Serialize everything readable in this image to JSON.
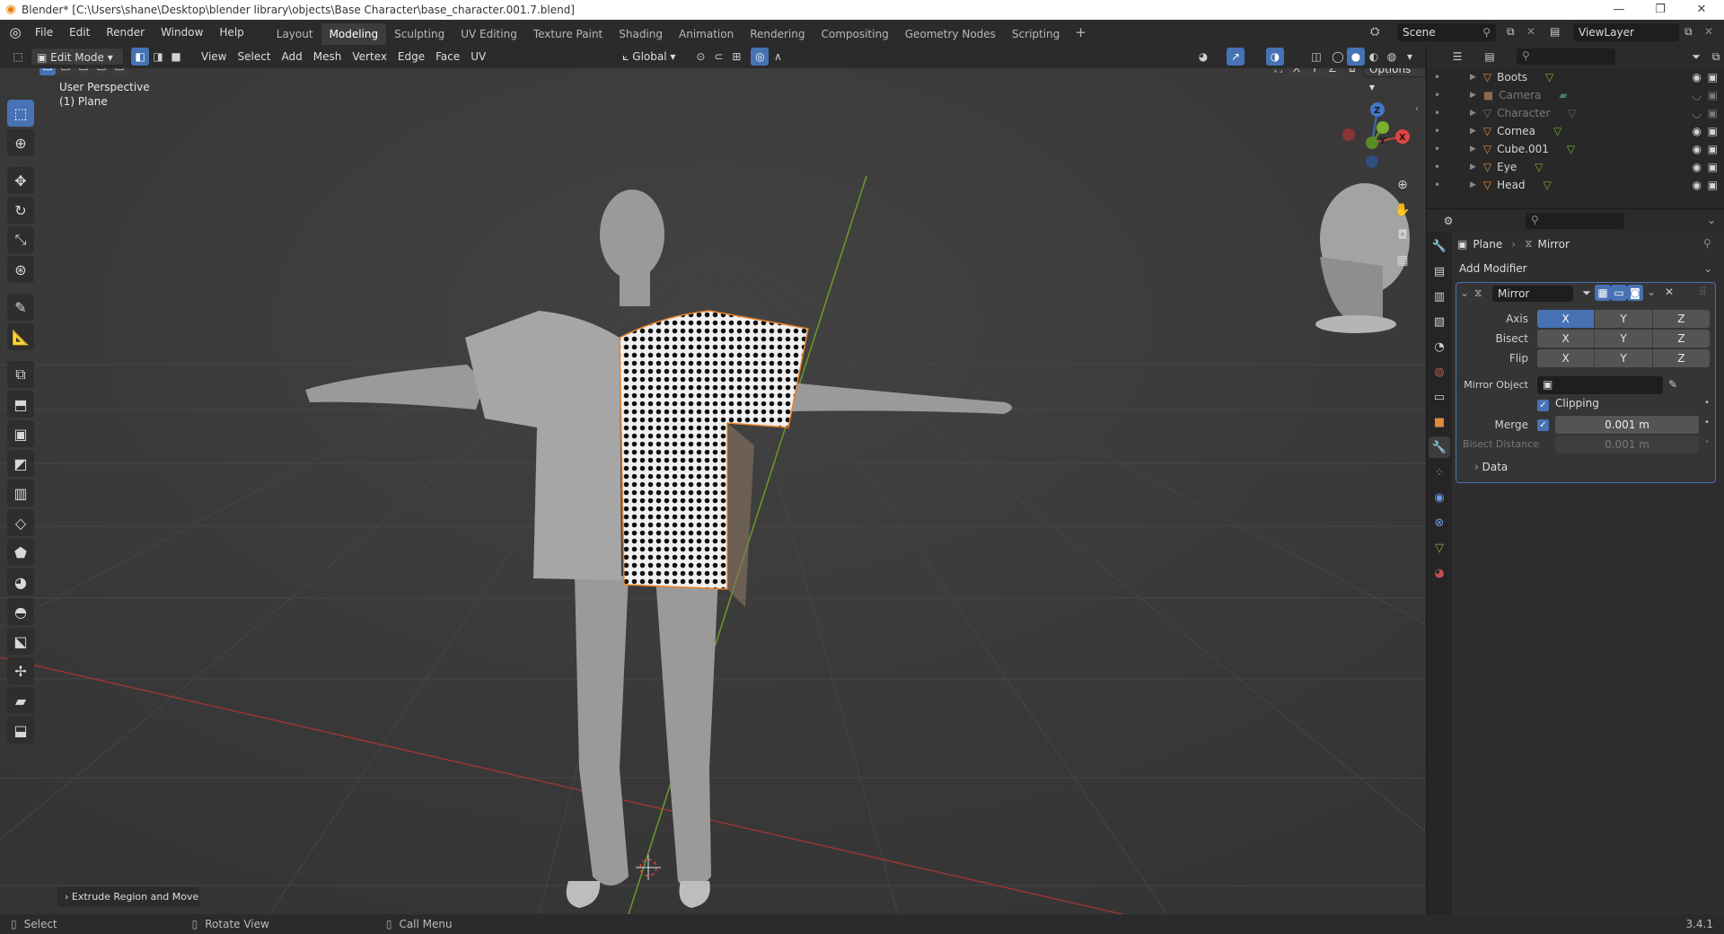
{
  "window": {
    "title": "Blender* [C:\\Users\\shane\\Desktop\\blender library\\objects\\Base Character\\base_character.001.7.blend]"
  },
  "menu": {
    "items": [
      "File",
      "Edit",
      "Render",
      "Window",
      "Help"
    ],
    "workspaces": [
      "Layout",
      "Modeling",
      "Sculpting",
      "UV Editing",
      "Texture Paint",
      "Shading",
      "Animation",
      "Rendering",
      "Compositing",
      "Geometry Nodes",
      "Scripting"
    ],
    "active_workspace": "Modeling",
    "scene": "Scene",
    "view_layer": "ViewLayer"
  },
  "viewport_header": {
    "mode": "Edit Mode",
    "menus": [
      "View",
      "Select",
      "Add",
      "Mesh",
      "Vertex",
      "Edge",
      "Face",
      "UV"
    ],
    "orientation": "Global",
    "options_label": "Options",
    "axes": [
      "X",
      "Y",
      "Z"
    ]
  },
  "viewport": {
    "perspective_label": "User Perspective",
    "object_label": "(1) Plane",
    "last_operator": "Extrude Region and Move",
    "gizmo_axes": [
      "X",
      "Y",
      "Z"
    ]
  },
  "outliner": {
    "items": [
      {
        "name": "Boots",
        "visible": true
      },
      {
        "name": "Camera",
        "visible": false
      },
      {
        "name": "Character",
        "visible": false
      },
      {
        "name": "Cornea",
        "visible": true
      },
      {
        "name": "Cube.001",
        "visible": true
      },
      {
        "name": "Eye",
        "visible": true
      },
      {
        "name": "Head",
        "visible": true
      }
    ]
  },
  "properties": {
    "breadcrumb_object": "Plane",
    "breadcrumb_modifier": "Mirror",
    "add_modifier_label": "Add Modifier",
    "modifier": {
      "name": "Mirror",
      "axis_label": "Axis",
      "bisect_label": "Bisect",
      "flip_label": "Flip",
      "axes": [
        "X",
        "Y",
        "Z"
      ],
      "axis_enabled": [
        true,
        false,
        false
      ],
      "mirror_object_label": "Mirror Object",
      "clipping_label": "Clipping",
      "clipping": true,
      "merge_label": "Merge",
      "merge_value": "0.001 m",
      "bisect_distance_label": "Bisect Distance",
      "bisect_distance_value": "0.001 m",
      "data_label": "Data"
    }
  },
  "statusbar": {
    "select": "Select",
    "rotate_view": "Rotate View",
    "call_menu": "Call Menu",
    "version": "3.4.1"
  },
  "colors": {
    "accent": "#4772b3",
    "selection_orange": "#e8822a",
    "viewport_bg": "#393939",
    "grid_x_red": "#b03a3a",
    "grid_y_green": "#6a9a2a"
  }
}
